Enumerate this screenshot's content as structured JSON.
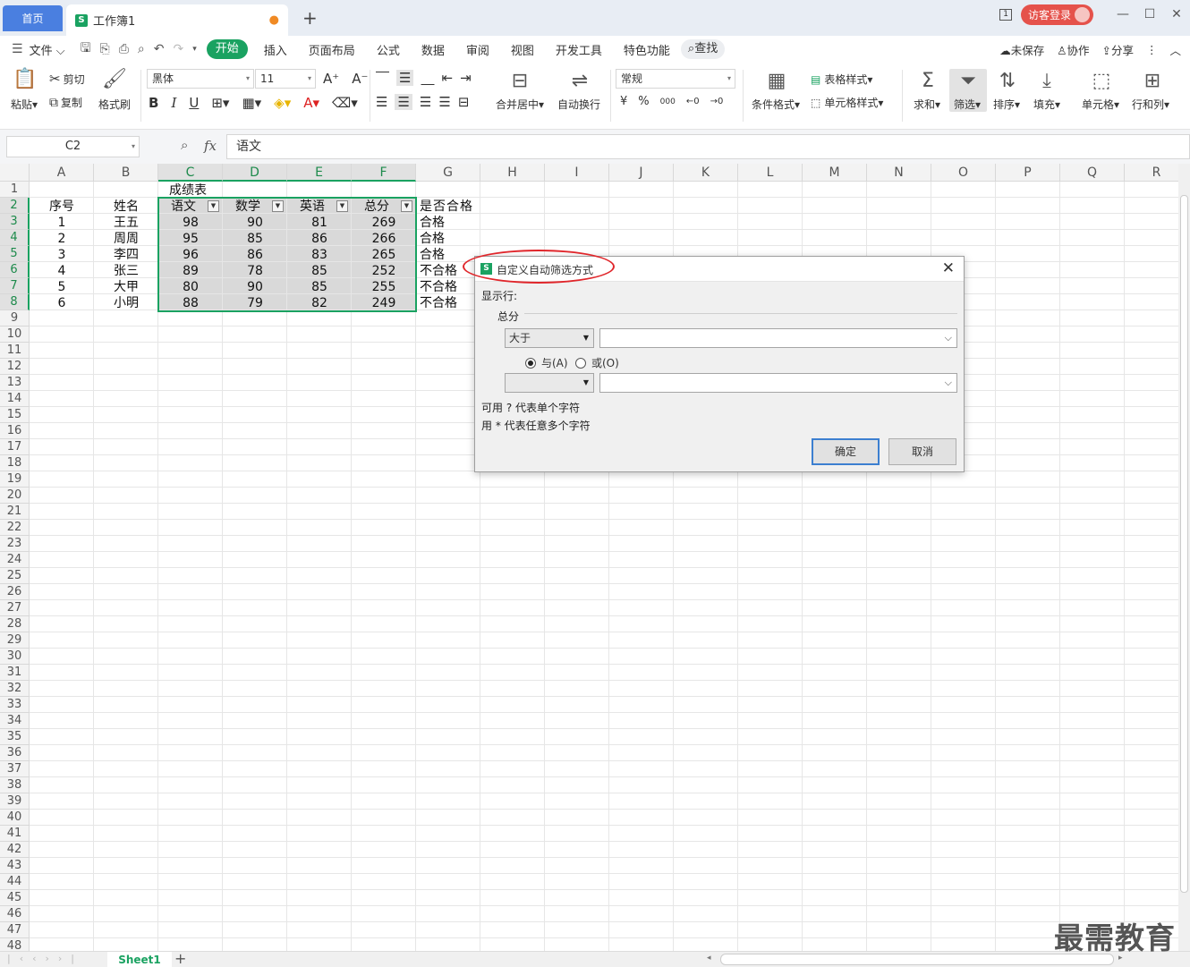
{
  "titlebar": {
    "home_tab": "首页",
    "doc_tab": "工作簿1",
    "doc_icon": "S",
    "unsaved_dot": "●",
    "new_tab": "+",
    "login_button": "访客登录",
    "win_page_indicator": "1",
    "min": "—",
    "max": "☐",
    "close": "✕"
  },
  "menu": {
    "file": "文件",
    "items": [
      "开始",
      "插入",
      "页面布局",
      "公式",
      "数据",
      "审阅",
      "视图",
      "开发工具",
      "特色功能"
    ],
    "search": "查找",
    "unsaved": "未保存",
    "collab": "协作",
    "share": "分享"
  },
  "ribbon": {
    "paste": "粘贴",
    "cut": "剪切",
    "copy": "复制",
    "format_painter": "格式刷",
    "font_name": "黑体",
    "font_size": "11",
    "bold": "B",
    "italic": "I",
    "underline": "U",
    "merge_center": "合并居中",
    "wrap_text": "自动换行",
    "number_format": "常规",
    "currency": "¥",
    "percent": "%",
    "thousands": "000",
    "cond_format": "条件格式",
    "table_style": "表格样式",
    "cell_style": "单元格样式",
    "sum": "求和",
    "filter": "筛选",
    "sort": "排序",
    "fill": "填充",
    "cell": "单元格",
    "row_col": "行和列"
  },
  "formula_bar": {
    "name_box": "C2",
    "fx": "fx",
    "content": "语文"
  },
  "sheet": {
    "columns": [
      "A",
      "B",
      "C",
      "D",
      "E",
      "F",
      "G",
      "H",
      "I",
      "J",
      "K",
      "L",
      "M",
      "N",
      "O",
      "P",
      "Q",
      "R"
    ],
    "title_cell": "成绩表",
    "headers": [
      "序号",
      "姓名",
      "语文",
      "数学",
      "英语",
      "总分",
      "是否合格"
    ],
    "rows": [
      [
        "1",
        "王五",
        "98",
        "90",
        "81",
        "269",
        "合格"
      ],
      [
        "2",
        "周周",
        "95",
        "85",
        "86",
        "266",
        "合格"
      ],
      [
        "3",
        "李四",
        "96",
        "86",
        "83",
        "265",
        "合格"
      ],
      [
        "4",
        "张三",
        "89",
        "78",
        "85",
        "252",
        "不合格"
      ],
      [
        "5",
        "大甲",
        "80",
        "90",
        "85",
        "255",
        "不合格"
      ],
      [
        "6",
        "小明",
        "88",
        "79",
        "82",
        "249",
        "不合格"
      ]
    ]
  },
  "bottom": {
    "sheet_tab": "Sheet1",
    "add_sheet": "+"
  },
  "dialog": {
    "title": "自定义自动筛选方式",
    "show_rows": "显示行:",
    "field": "总分",
    "op1": "大于",
    "value1": "",
    "and_label": "与(A)",
    "or_label": "或(O)",
    "and_selected": true,
    "op2": "",
    "value2": "",
    "hint1": "可用 ? 代表单个字符",
    "hint2": "用 * 代表任意多个字符",
    "ok": "确定",
    "cancel": "取消",
    "close": "✕"
  },
  "watermark": "最需教育",
  "colors": {
    "accent": "#1aa261",
    "home_tab": "#4a7fe0",
    "login": "#e5524b",
    "highlight_oval": "#e0262b"
  }
}
